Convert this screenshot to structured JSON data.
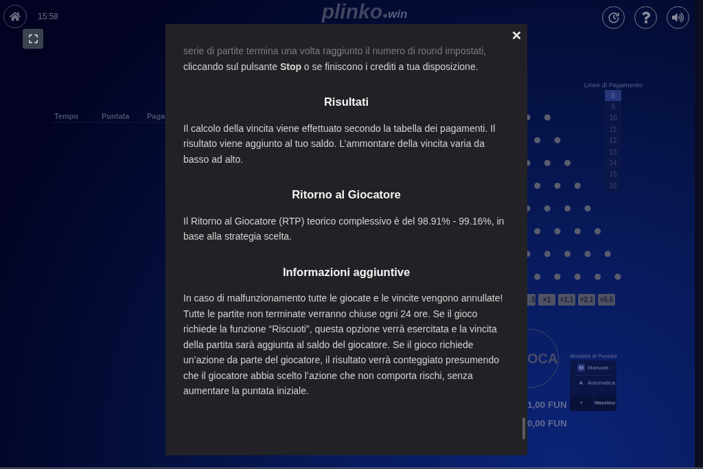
{
  "header": {
    "time": "15:58",
    "logo": {
      "text": "plinko",
      "suffix": "win"
    }
  },
  "history_table": {
    "columns": [
      "Tempo",
      "Puntata",
      "Paga"
    ]
  },
  "rules_dialog": {
    "blocks": [
      {
        "kind": "paragraph",
        "text": "serie di partite termina una volta raggiunto il numero di round impostati, cliccando sul pulsante **Stop** o se finiscono i crediti a tua disposizione."
      },
      {
        "kind": "heading",
        "text": "Risultati"
      },
      {
        "kind": "paragraph",
        "text": "Il calcolo della vincita viene effettuato secondo la tabella dei pagamenti. Il risultato viene aggiunto al tuo saldo. L’ammontare della vincita varia da basso ad alto."
      },
      {
        "kind": "heading",
        "text": "Ritorno al Giocatore"
      },
      {
        "kind": "paragraph",
        "text": "Il Ritorno al Giocatore (RTP) teorico complessivo è del 98.91% - 99.16%, in base alla strategia scelta."
      },
      {
        "kind": "heading",
        "text": "Informazioni aggiuntive"
      },
      {
        "kind": "paragraph",
        "text": "In caso di malfunzionamento tutte le giocate e le vincite vengono annullate! Tutte le partite non terminate verranno chiuse ogni 24 ore. Se il gioco richiede la funzione “Riscuoti”, questa opzione verrà esercitata e la vincita della partita sarà aggiunta al saldo del giocatore. Se il gioco richiede un’azione da parte del giocatore, il risultato verrà conteggiato presumendo che il giocatore abbia scelto l’azione che non comporta rischi, senza aumentare la puntata iniziale."
      }
    ]
  },
  "game": {
    "paylines": {
      "label": "Linee di Pagamento",
      "options": [
        {
          "label": "8",
          "selected": true
        },
        {
          "label": "9",
          "selected": false
        },
        {
          "label": "10",
          "selected": false
        },
        {
          "label": "11",
          "selected": false
        },
        {
          "label": "12",
          "selected": false
        },
        {
          "label": "13",
          "selected": false
        },
        {
          "label": "14",
          "selected": false
        },
        {
          "label": "15",
          "selected": false
        },
        {
          "label": "16",
          "selected": false
        }
      ]
    },
    "multipliers": [
      ".5",
      "×1",
      "×1.1",
      "×2.1",
      "×5.6"
    ],
    "play_button": "OCA",
    "bet_amount": "1,00 FUN",
    "balance": "0,00 FUN",
    "bet_mode": {
      "label": "Modalità di Puntata",
      "options": [
        {
          "key": "M",
          "label": "Manuale",
          "selected": true
        },
        {
          "key": "A",
          "label": "Automatica",
          "selected": false
        }
      ],
      "buttons": [
        "+",
        "Massimo"
      ]
    }
  }
}
